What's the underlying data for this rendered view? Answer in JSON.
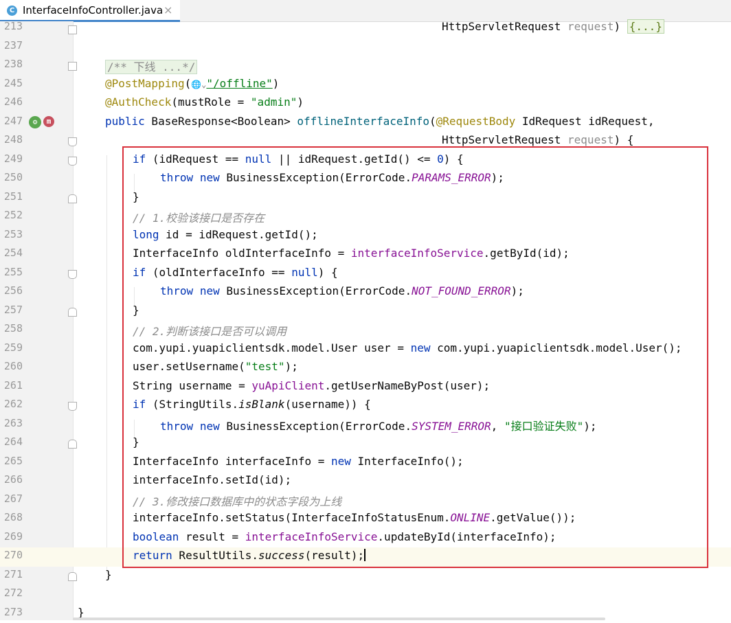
{
  "tab": {
    "icon": "C",
    "title": "InterfaceInfoController.java",
    "close": "×"
  },
  "lines": [
    {
      "n": "213"
    },
    {
      "n": "237"
    },
    {
      "n": "238"
    },
    {
      "n": "245"
    },
    {
      "n": "246"
    },
    {
      "n": "247"
    },
    {
      "n": "248"
    },
    {
      "n": "249"
    },
    {
      "n": "250"
    },
    {
      "n": "251"
    },
    {
      "n": "252"
    },
    {
      "n": "253"
    },
    {
      "n": "254"
    },
    {
      "n": "255"
    },
    {
      "n": "256"
    },
    {
      "n": "257"
    },
    {
      "n": "258"
    },
    {
      "n": "259"
    },
    {
      "n": "260"
    },
    {
      "n": "261"
    },
    {
      "n": "262"
    },
    {
      "n": "263"
    },
    {
      "n": "264"
    },
    {
      "n": "265"
    },
    {
      "n": "266"
    },
    {
      "n": "267"
    },
    {
      "n": "268"
    },
    {
      "n": "269"
    },
    {
      "n": "270"
    },
    {
      "n": "271"
    },
    {
      "n": "272"
    },
    {
      "n": "273"
    }
  ],
  "code": {
    "l213_a": "HttpServletRequest ",
    "l213_b": "request",
    "l213_c": ") ",
    "l213_d": "{...}",
    "l238": "/** 下线 ...*/",
    "l245_ann": "@PostMapping",
    "l245_open": "(",
    "l245_icon": "🌐⌄",
    "l245_str": "\"/offline\"",
    "l245_close": ")",
    "l246_ann": "@AuthCheck",
    "l246_a": "(mustRole = ",
    "l246_str": "\"admin\"",
    "l246_b": ")",
    "l247_kw": "public",
    "l247_a": " BaseResponse<Boolean> ",
    "l247_m": "offlineInterfaceInfo",
    "l247_b": "(",
    "l247_ann": "@RequestBody",
    "l247_c": " IdRequest idRequest,",
    "l248_a": "HttpServletRequest ",
    "l248_b": "request",
    "l248_c": ") {",
    "l249_kw": "if",
    "l249_a": " (idRequest == ",
    "l249_null": "null",
    "l249_b": " || idRequest.getId() <= ",
    "l249_num": "0",
    "l249_c": ") {",
    "throw": "throw",
    "new": "new",
    "be": " BusinessException(ErrorCode.",
    "l250_c": "PARAMS_ERROR",
    "end_paren": ");",
    "brace": "}",
    "l252": "// 1.校验该接口是否存在",
    "l253_kw": "long",
    "l253_a": " id = idRequest.getId();",
    "l254_a": "InterfaceInfo oldInterfaceInfo = ",
    "l254_f": "interfaceInfoService",
    "l254_b": ".getById(id);",
    "l255_kw": "if",
    "l255_a": " (oldInterfaceInfo == ",
    "l255_null": "null",
    "l255_b": ") {",
    "l256_c": "NOT_FOUND_ERROR",
    "l258": "// 2.判断该接口是否可以调用",
    "l259_a": "com.yupi.yuapiclientsdk.model.User user = ",
    "l259_kw": "new",
    "l259_b": " com.yupi.yuapiclientsdk.model.User();",
    "l260_a": "user.setUsername(",
    "l260_str": "\"test\"",
    "l260_b": ");",
    "l261_a": "String username = ",
    "l261_f": "yuApiClient",
    "l261_b": ".getUserNameByPost(user);",
    "l262_kw": "if",
    "l262_a": " (StringUtils.",
    "l262_s": "isBlank",
    "l262_b": "(username)) {",
    "l263_c": "SYSTEM_ERROR",
    "l263_comma": ", ",
    "l263_str": "\"接口验证失败\"",
    "l265_a": "InterfaceInfo interfaceInfo = ",
    "l265_kw": "new",
    "l265_b": " InterfaceInfo();",
    "l266": "interfaceInfo.setId(id);",
    "l267": "// 3.修改接口数据库中的状态字段为上线",
    "l268_a": "interfaceInfo.setStatus(InterfaceInfoStatusEnum.",
    "l268_c": "ONLINE",
    "l268_b": ".getValue());",
    "l269_kw": "boolean",
    "l269_a": " result = ",
    "l269_f": "interfaceInfoService",
    "l269_b": ".updateById(interfaceInfo);",
    "l270_kw": "return",
    "l270_a": " ResultUtils.",
    "l270_s": "success",
    "l270_b": "(result);"
  },
  "gutter_icons": {
    "bean": "bean-icon",
    "mapping": "m"
  },
  "colors": {
    "keyword": "#0033b3",
    "annotation": "#9e880d",
    "string": "#067d17",
    "field": "#871094",
    "highlight_box": "#d9303b"
  }
}
